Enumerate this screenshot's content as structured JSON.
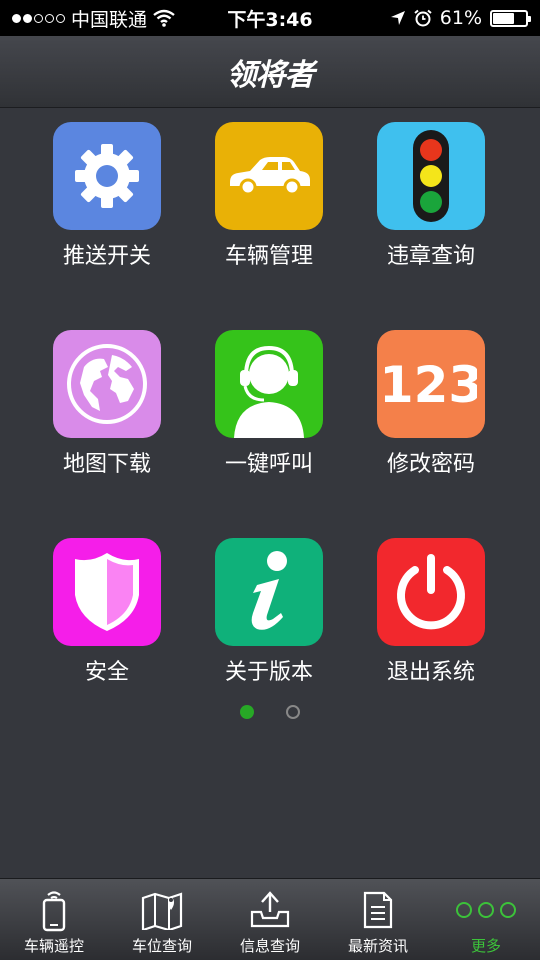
{
  "status_bar": {
    "carrier": "中国联通",
    "time": "下午3:46",
    "battery_percent": "61%",
    "battery_level": 0.61,
    "signal_bars_filled": 2,
    "signal_bars_total": 5
  },
  "header": {
    "logo_text": "领将者"
  },
  "grid": {
    "items": [
      {
        "label": "推送开关",
        "icon": "gear-icon",
        "color": "#5b86e0"
      },
      {
        "label": "车辆管理",
        "icon": "car-icon",
        "color": "#e9b106"
      },
      {
        "label": "违章查询",
        "icon": "traffic-light-icon",
        "color": "#3fc0ee"
      },
      {
        "label": "地图下载",
        "icon": "globe-icon",
        "color": "#d98be9"
      },
      {
        "label": "一键呼叫",
        "icon": "headset-agent-icon",
        "color": "#35c31a"
      },
      {
        "label": "修改密码",
        "icon": "number-123-icon",
        "color": "#f4804a"
      },
      {
        "label": "安全",
        "icon": "shield-icon",
        "color": "#f51ee9"
      },
      {
        "label": "关于版本",
        "icon": "info-icon",
        "color": "#0fb17a"
      },
      {
        "label": "退出系统",
        "icon": "power-icon",
        "color": "#f2282d"
      }
    ]
  },
  "pager": {
    "current": 1,
    "total": 2
  },
  "tab_bar": {
    "items": [
      {
        "label": "车辆遥控",
        "icon": "phone-remote-icon"
      },
      {
        "label": "车位查询",
        "icon": "map-location-icon"
      },
      {
        "label": "信息查询",
        "icon": "upload-tray-icon"
      },
      {
        "label": "最新资讯",
        "icon": "document-icon"
      },
      {
        "label": "更多",
        "icon": "more-dots-icon"
      }
    ],
    "active_index": 4,
    "active_color": "#3cc23a"
  }
}
